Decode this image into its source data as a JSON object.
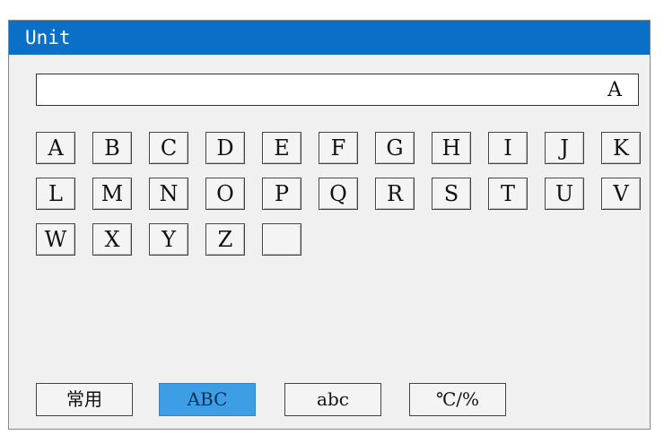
{
  "window": {
    "title": "Unit"
  },
  "display": {
    "value": "A"
  },
  "keys": [
    "A",
    "B",
    "C",
    "D",
    "E",
    "F",
    "G",
    "H",
    "I",
    "J",
    "K",
    "L",
    "M",
    "N",
    "O",
    "P",
    "Q",
    "R",
    "S",
    "T",
    "U",
    "V",
    "W",
    "X",
    "Y",
    "Z",
    ""
  ],
  "modes": [
    {
      "label": "常用",
      "active": false
    },
    {
      "label": "ABC",
      "active": true
    },
    {
      "label": "abc",
      "active": false
    },
    {
      "label": "℃/%",
      "active": false
    }
  ],
  "colors": {
    "titlebar": "#0a6fc7",
    "active_mode": "#3d9ee6",
    "panel": "#f0f0f0"
  }
}
